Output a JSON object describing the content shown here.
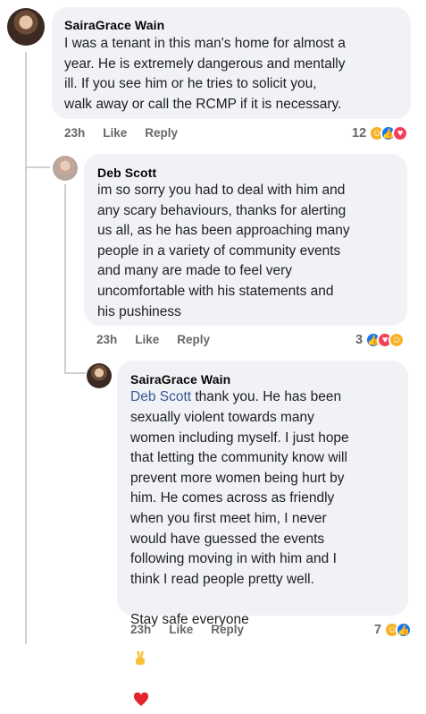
{
  "comments": [
    {
      "author": "SairaGrace Wain",
      "text": "I was a tenant in this man's home for almost a\nyear. He is extremely dangerous and mentally\nill. If you see him or he tries to solicit you,\nwalk away or call the RCMP if it is necessary.",
      "time": "23h",
      "like_label": "Like",
      "reply_label": "Reply",
      "reaction_count": "12",
      "reactions": [
        "care",
        "like",
        "love"
      ]
    },
    {
      "author": "Deb Scott",
      "text": "im so sorry you had to deal with him and\nany scary behaviours, thanks for alerting\nus all, as he has been approaching many\npeople in a variety of community events\nand many are made to feel very\nuncomfortable with his statements and\nhis pushiness",
      "time": "23h",
      "like_label": "Like",
      "reply_label": "Reply",
      "reaction_count": "3",
      "reactions": [
        "like",
        "love",
        "care"
      ]
    },
    {
      "author": "SairaGrace Wain",
      "mention": "Deb Scott",
      "text_first": " thank you. He has been",
      "text": "sexually violent towards many\nwomen including myself. I just hope\nthat letting the community know will\nprevent more women being hurt by\nhim. He comes across as friendly\nwhen you first meet him, I never\nwould have guessed the events\nfollowing moving in with him and I\nthink I read people pretty well.",
      "text_last": "Stay safe everyone",
      "time": "23h",
      "like_label": "Like",
      "reply_label": "Reply",
      "reaction_count": "7",
      "reactions": [
        "care",
        "like"
      ]
    }
  ],
  "colors": {
    "bubble": "#f0f2f5",
    "meta": "#65676b",
    "mention": "#385898",
    "like": "#1877f2",
    "love": "#f33e58",
    "care": "#f7b125"
  }
}
